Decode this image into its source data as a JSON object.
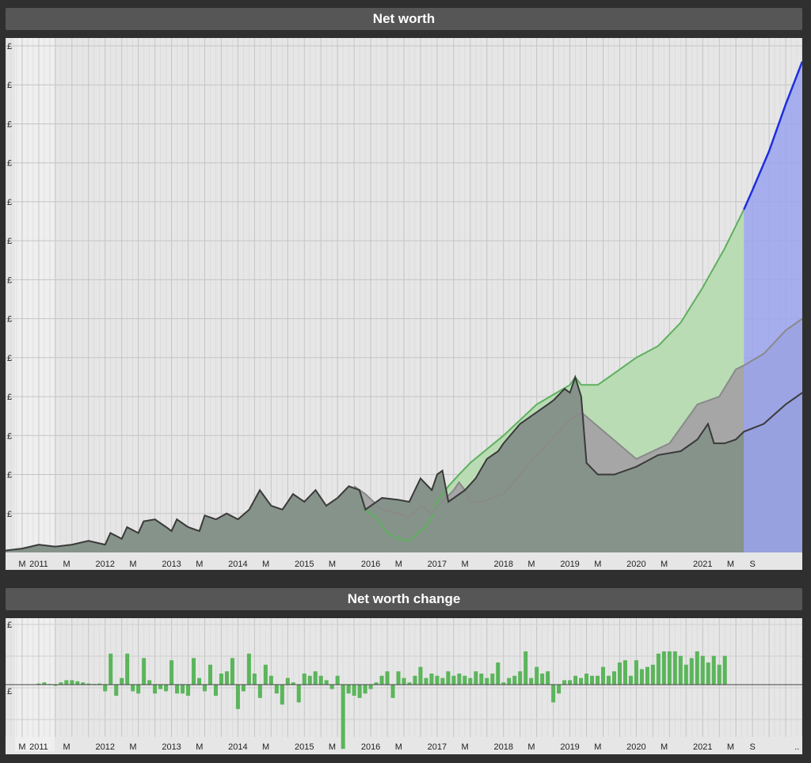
{
  "titles": {
    "net_worth": "Net worth",
    "net_worth_change": "Net worth change"
  },
  "colors": {
    "panel_bg": "#565656",
    "plot_bg": "#e6e6e6",
    "actual_line": "#3a3a3a",
    "actual_fill": "#86938a",
    "planned_line": "#5db05d",
    "planned_fill": "#b9dcb4",
    "alt_line": "#8a8a8a",
    "alt_fill": "#a6a6a6",
    "forecast_line": "#1d2ee0",
    "forecast_fill": "#9aa3ee",
    "bar_positive": "#5bb55b",
    "bar_forecast": "#1d2ee0"
  },
  "chart_data": [
    {
      "type": "area",
      "title": "Net worth",
      "x_start_year": 2010.5,
      "x_end_year": 2022.5,
      "ylim": [
        0,
        13
      ],
      "grid": true,
      "legend": "none",
      "y_tick_labels": [
        "£",
        "£",
        "£",
        "£",
        "£",
        "£",
        "£",
        "£",
        "£",
        "£",
        "£",
        "£",
        "£"
      ],
      "x_ticks": [
        {
          "x": 2010.75,
          "label": "M"
        },
        {
          "x": 2011.0,
          "label": "2011"
        },
        {
          "x": 2011.42,
          "label": "M"
        },
        {
          "x": 2012.0,
          "label": "2012"
        },
        {
          "x": 2012.42,
          "label": "M"
        },
        {
          "x": 2013.0,
          "label": "2013"
        },
        {
          "x": 2013.42,
          "label": "M"
        },
        {
          "x": 2014.0,
          "label": "2014"
        },
        {
          "x": 2014.42,
          "label": "M"
        },
        {
          "x": 2015.0,
          "label": "2015"
        },
        {
          "x": 2015.42,
          "label": "M"
        },
        {
          "x": 2016.0,
          "label": "2016"
        },
        {
          "x": 2016.42,
          "label": "M"
        },
        {
          "x": 2017.0,
          "label": "2017"
        },
        {
          "x": 2017.42,
          "label": "M"
        },
        {
          "x": 2018.0,
          "label": "2018"
        },
        {
          "x": 2018.42,
          "label": "M"
        },
        {
          "x": 2019.0,
          "label": "2019"
        },
        {
          "x": 2019.42,
          "label": "M"
        },
        {
          "x": 2020.0,
          "label": "2020"
        },
        {
          "x": 2020.42,
          "label": "M"
        },
        {
          "x": 2021.0,
          "label": "2021"
        },
        {
          "x": 2021.42,
          "label": "M"
        },
        {
          "x": 2021.75,
          "label": "S"
        }
      ],
      "forecast_start": 2021.62,
      "series": [
        {
          "role": "planned",
          "points": [
            [
              2015.75,
              1.7
            ],
            [
              2015.83,
              1.6
            ],
            [
              2015.92,
              1.1
            ],
            [
              2016.0,
              1.0
            ],
            [
              2016.08,
              0.9
            ],
            [
              2016.17,
              0.7
            ],
            [
              2016.25,
              0.5
            ],
            [
              2016.42,
              0.35
            ],
            [
              2016.58,
              0.3
            ],
            [
              2016.75,
              0.55
            ],
            [
              2016.83,
              0.65
            ],
            [
              2016.92,
              0.9
            ],
            [
              2017.0,
              1.3
            ],
            [
              2017.17,
              1.7
            ],
            [
              2017.33,
              2.0
            ],
            [
              2017.5,
              2.3
            ],
            [
              2018.0,
              3.0
            ],
            [
              2018.5,
              3.8
            ],
            [
              2019.0,
              4.3
            ],
            [
              2019.08,
              4.5
            ],
            [
              2019.17,
              4.3
            ],
            [
              2019.42,
              4.3
            ],
            [
              2019.67,
              4.6
            ],
            [
              2020.0,
              5.0
            ],
            [
              2020.33,
              5.3
            ],
            [
              2020.67,
              5.9
            ],
            [
              2021.0,
              6.8
            ],
            [
              2021.33,
              7.8
            ],
            [
              2021.62,
              8.8
            ]
          ]
        },
        {
          "role": "alt",
          "points": [
            [
              2015.75,
              1.7
            ],
            [
              2015.92,
              1.5
            ],
            [
              2016.17,
              1.1
            ],
            [
              2016.42,
              1.0
            ],
            [
              2016.58,
              0.9
            ],
            [
              2016.75,
              1.2
            ],
            [
              2016.92,
              1.0
            ],
            [
              2017.08,
              1.3
            ],
            [
              2017.25,
              1.6
            ],
            [
              2017.33,
              1.8
            ],
            [
              2017.42,
              1.6
            ],
            [
              2017.5,
              1.3
            ],
            [
              2017.67,
              1.3
            ],
            [
              2018.0,
              1.5
            ],
            [
              2018.5,
              2.5
            ],
            [
              2019.0,
              3.4
            ],
            [
              2019.17,
              3.6
            ],
            [
              2020.0,
              2.4
            ],
            [
              2020.5,
              2.8
            ],
            [
              2020.92,
              3.8
            ],
            [
              2021.25,
              4.0
            ],
            [
              2021.5,
              4.7
            ],
            [
              2021.62,
              4.8
            ],
            [
              2021.92,
              5.1
            ],
            [
              2022.25,
              5.7
            ],
            [
              2022.5,
              6.0
            ]
          ]
        },
        {
          "role": "actual",
          "points": [
            [
              2010.5,
              0.05
            ],
            [
              2010.75,
              0.1
            ],
            [
              2011.0,
              0.2
            ],
            [
              2011.25,
              0.15
            ],
            [
              2011.5,
              0.2
            ],
            [
              2011.75,
              0.3
            ],
            [
              2012.0,
              0.2
            ],
            [
              2012.08,
              0.5
            ],
            [
              2012.25,
              0.35
            ],
            [
              2012.33,
              0.65
            ],
            [
              2012.5,
              0.5
            ],
            [
              2012.58,
              0.8
            ],
            [
              2012.75,
              0.85
            ],
            [
              2012.92,
              0.65
            ],
            [
              2013.0,
              0.55
            ],
            [
              2013.08,
              0.85
            ],
            [
              2013.25,
              0.65
            ],
            [
              2013.42,
              0.55
            ],
            [
              2013.5,
              0.95
            ],
            [
              2013.67,
              0.85
            ],
            [
              2013.83,
              1.0
            ],
            [
              2014.0,
              0.85
            ],
            [
              2014.17,
              1.1
            ],
            [
              2014.33,
              1.6
            ],
            [
              2014.5,
              1.2
            ],
            [
              2014.67,
              1.1
            ],
            [
              2014.83,
              1.5
            ],
            [
              2015.0,
              1.3
            ],
            [
              2015.17,
              1.6
            ],
            [
              2015.33,
              1.2
            ],
            [
              2015.5,
              1.4
            ],
            [
              2015.67,
              1.7
            ],
            [
              2015.83,
              1.6
            ],
            [
              2015.92,
              1.1
            ],
            [
              2016.17,
              1.4
            ],
            [
              2016.42,
              1.35
            ],
            [
              2016.58,
              1.3
            ],
            [
              2016.75,
              1.9
            ],
            [
              2016.92,
              1.6
            ],
            [
              2017.0,
              2.0
            ],
            [
              2017.08,
              2.1
            ],
            [
              2017.17,
              1.3
            ],
            [
              2017.42,
              1.6
            ],
            [
              2017.58,
              1.9
            ],
            [
              2017.75,
              2.4
            ],
            [
              2017.92,
              2.6
            ],
            [
              2018.0,
              2.8
            ],
            [
              2018.25,
              3.3
            ],
            [
              2018.5,
              3.6
            ],
            [
              2018.75,
              3.9
            ],
            [
              2018.92,
              4.2
            ],
            [
              2019.0,
              4.1
            ],
            [
              2019.08,
              4.5
            ],
            [
              2019.17,
              4.0
            ],
            [
              2019.25,
              2.3
            ],
            [
              2019.42,
              2.0
            ],
            [
              2019.67,
              2.0
            ],
            [
              2020.0,
              2.2
            ],
            [
              2020.33,
              2.5
            ],
            [
              2020.67,
              2.6
            ],
            [
              2020.92,
              2.9
            ],
            [
              2021.0,
              3.1
            ],
            [
              2021.08,
              3.3
            ],
            [
              2021.17,
              2.8
            ],
            [
              2021.33,
              2.8
            ],
            [
              2021.5,
              2.9
            ],
            [
              2021.62,
              3.1
            ],
            [
              2021.92,
              3.3
            ],
            [
              2022.25,
              3.8
            ],
            [
              2022.5,
              4.1
            ]
          ]
        },
        {
          "role": "forecast",
          "points": [
            [
              2021.62,
              8.8
            ],
            [
              2021.75,
              9.3
            ],
            [
              2022.0,
              10.3
            ],
            [
              2022.25,
              11.5
            ],
            [
              2022.5,
              12.6
            ]
          ]
        }
      ]
    },
    {
      "type": "bar",
      "title": "Net worth change",
      "x_start_year": 2010.5,
      "x_end_year": 2022.5,
      "ylim": [
        -3,
        3
      ],
      "grid": true,
      "legend": "none",
      "y_tick_labels": [
        "£",
        "£"
      ],
      "x_ticks": [
        {
          "x": 2010.75,
          "label": "M"
        },
        {
          "x": 2011.0,
          "label": "2011"
        },
        {
          "x": 2011.42,
          "label": "M"
        },
        {
          "x": 2012.0,
          "label": "2012"
        },
        {
          "x": 2012.42,
          "label": "M"
        },
        {
          "x": 2013.0,
          "label": "2013"
        },
        {
          "x": 2013.42,
          "label": "M"
        },
        {
          "x": 2014.0,
          "label": "2014"
        },
        {
          "x": 2014.42,
          "label": "M"
        },
        {
          "x": 2015.0,
          "label": "2015"
        },
        {
          "x": 2015.42,
          "label": "M"
        },
        {
          "x": 2016.0,
          "label": "2016"
        },
        {
          "x": 2016.42,
          "label": "M"
        },
        {
          "x": 2017.0,
          "label": "2017"
        },
        {
          "x": 2017.42,
          "label": "M"
        },
        {
          "x": 2018.0,
          "label": "2018"
        },
        {
          "x": 2018.42,
          "label": "M"
        },
        {
          "x": 2019.0,
          "label": "2019"
        },
        {
          "x": 2019.42,
          "label": "M"
        },
        {
          "x": 2020.0,
          "label": "2020"
        },
        {
          "x": 2020.42,
          "label": "M"
        },
        {
          "x": 2021.0,
          "label": "2021"
        },
        {
          "x": 2021.42,
          "label": "M"
        },
        {
          "x": 2021.75,
          "label": "S"
        },
        {
          "x": 2022.42,
          "label": ".."
        }
      ],
      "forecast_start": 2021.62,
      "values": [
        0.05,
        0.1,
        0.03,
        -0.05,
        0.1,
        0.2,
        0.2,
        0.15,
        0.1,
        0.05,
        0.03,
        0.05,
        -0.3,
        1.4,
        -0.5,
        0.3,
        1.4,
        -0.3,
        -0.4,
        1.2,
        0.2,
        -0.4,
        -0.2,
        -0.3,
        1.1,
        -0.4,
        -0.4,
        -0.5,
        1.2,
        0.3,
        -0.3,
        0.9,
        -0.5,
        0.5,
        0.6,
        1.2,
        -1.1,
        -0.3,
        1.4,
        0.5,
        -0.6,
        0.9,
        0.4,
        -0.4,
        -0.9,
        0.3,
        0.1,
        -0.8,
        0.5,
        0.4,
        0.6,
        0.4,
        0.2,
        -0.2,
        0.4,
        -2.9,
        -0.4,
        -0.5,
        -0.6,
        -0.4,
        -0.2,
        0.1,
        0.4,
        0.6,
        -0.6,
        0.6,
        0.3,
        0.1,
        0.4,
        0.8,
        0.3,
        0.5,
        0.4,
        0.3,
        0.6,
        0.4,
        0.5,
        0.4,
        0.3,
        0.6,
        0.5,
        0.3,
        0.5,
        1.0,
        0.1,
        0.3,
        0.4,
        0.6,
        1.5,
        0.3,
        0.8,
        0.5,
        0.6,
        -0.8,
        -0.4,
        0.2,
        0.2,
        0.4,
        0.3,
        0.5,
        0.4,
        0.4,
        0.8,
        0.4,
        0.6,
        1.0,
        1.1,
        0.4,
        1.1,
        0.7,
        0.8,
        0.9,
        1.4,
        1.5,
        1.5,
        1.5,
        1.3,
        0.9,
        1.2,
        1.5,
        1.3,
        1.0,
        1.3,
        0.9,
        1.3
      ]
    }
  ]
}
